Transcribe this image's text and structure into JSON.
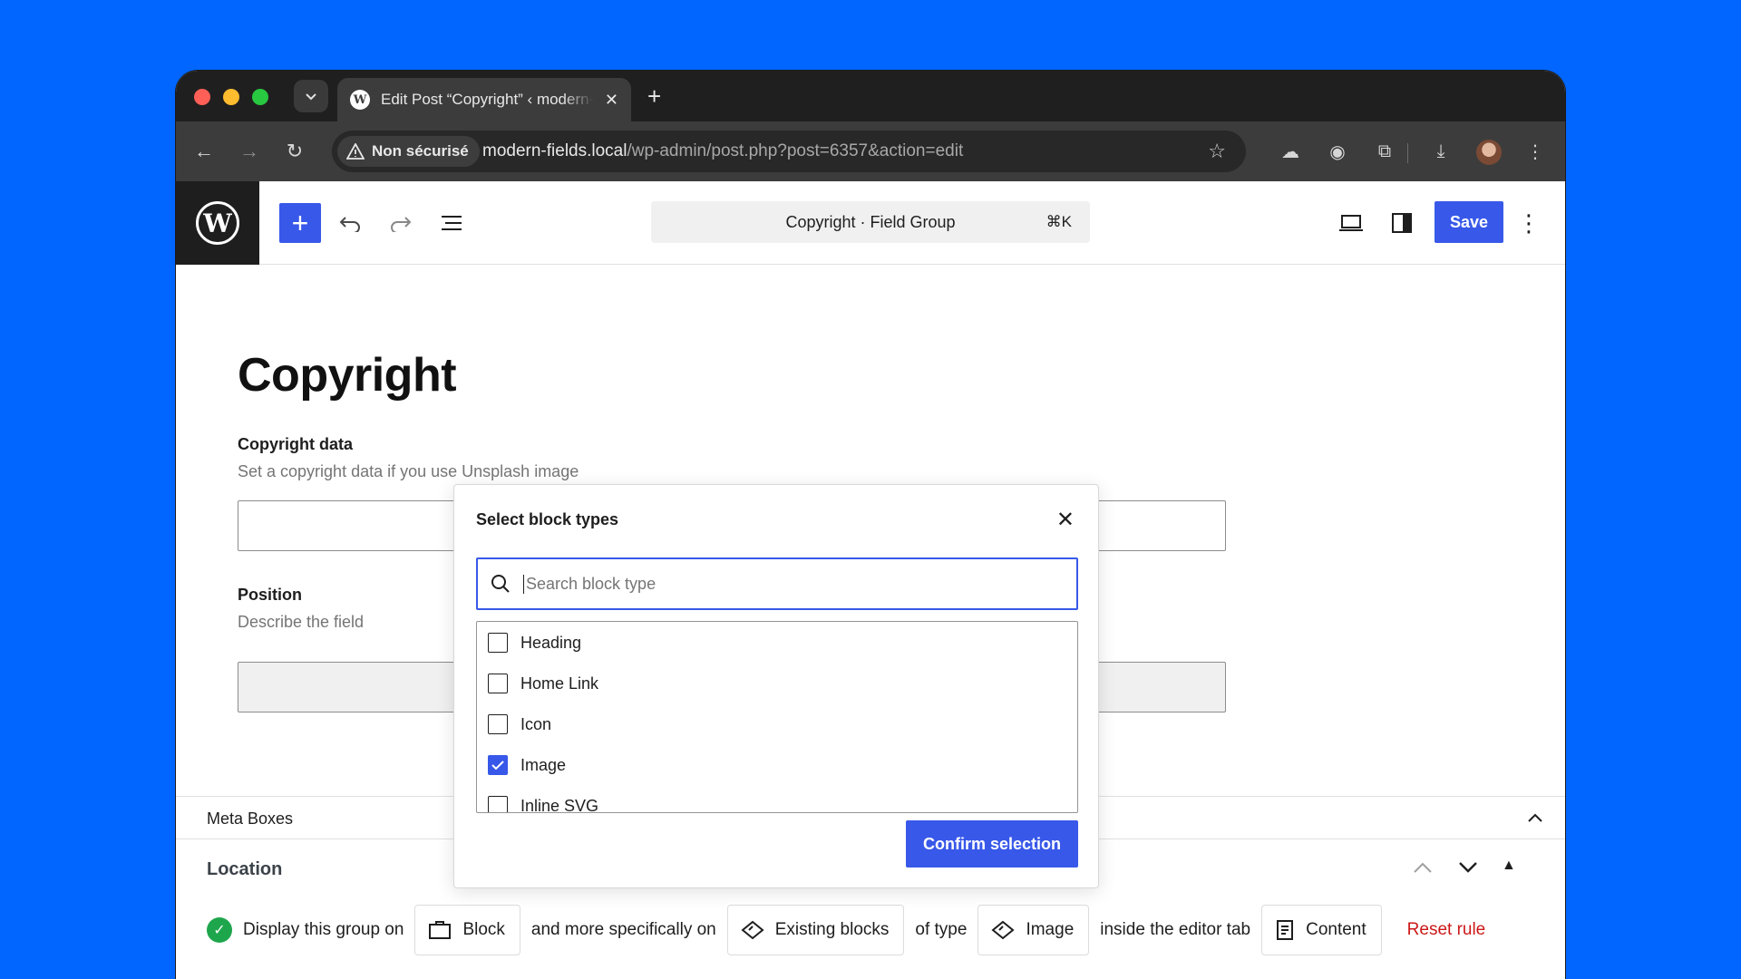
{
  "browser": {
    "tab_title": "Edit Post “Copyright” ‹ modern-fields — WordPress",
    "new_tab": "+",
    "security_label": "Non sécurisé",
    "url_host": "modern-fields.local",
    "url_path": "/wp-admin/post.php?post=6357&action=edit"
  },
  "editor": {
    "command_title": "Copyright · Field Group",
    "command_shortcut": "⌘K",
    "save_label": "Save",
    "post_title": "Copyright",
    "fields": [
      {
        "label": "Copyright data",
        "description": "Set a copyright data if you use Unsplash image"
      },
      {
        "label": "Position",
        "description": "Describe the field"
      }
    ]
  },
  "meta": {
    "title": "Meta Boxes",
    "location_title": "Location",
    "rule": {
      "prefix": "Display this group on",
      "chip1": "Block",
      "mid1": "and more specifically on",
      "chip2": "Existing blocks",
      "mid2": "of type",
      "chip3": "Image",
      "mid3": "inside the editor tab",
      "chip4": "Content",
      "reset": "Reset rule"
    }
  },
  "modal": {
    "title": "Select block types",
    "search_placeholder": "Search block type",
    "items": [
      {
        "label": "Heading",
        "checked": false
      },
      {
        "label": "Home Link",
        "checked": false
      },
      {
        "label": "Icon",
        "checked": false
      },
      {
        "label": "Image",
        "checked": true
      },
      {
        "label": "Inline SVG",
        "checked": false
      }
    ],
    "confirm_label": "Confirm selection"
  },
  "colors": {
    "accent": "#3858e9",
    "background": "#0066ff",
    "danger": "#cc1818",
    "success": "#1ea64c"
  }
}
